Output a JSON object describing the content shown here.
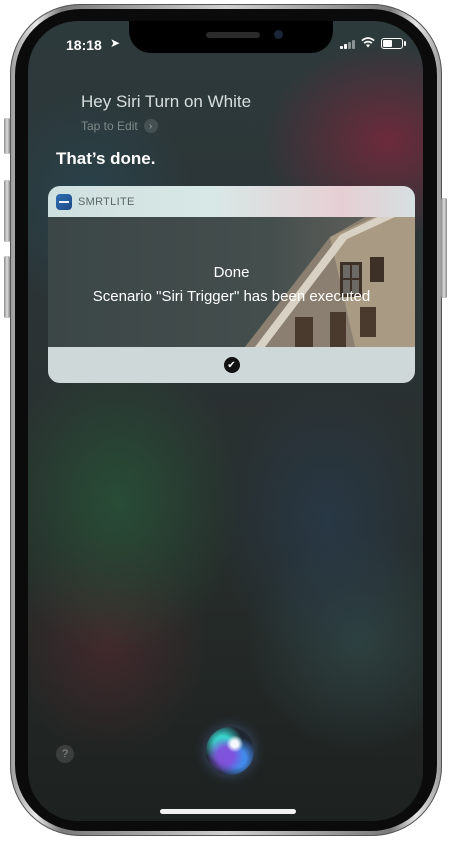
{
  "status_bar": {
    "time": "18:18",
    "location_icon": "location-arrow-icon",
    "signal_icon": "cellular-signal-icon",
    "wifi_icon": "wifi-icon",
    "battery_icon": "battery-icon",
    "battery_level": 0.5
  },
  "siri": {
    "query": "Hey Siri Turn on White",
    "tap_to_edit": "Tap to Edit",
    "response": "That’s done."
  },
  "card": {
    "app_name": "SMRTLITE",
    "title": "Done",
    "message": "Scenario \"Siri Trigger\" has been executed",
    "confirm_icon": "checkmark-icon"
  },
  "bottom": {
    "help_label": "?",
    "siri_icon": "siri-orb-icon"
  },
  "colors": {
    "card_header": "#d8e8e6",
    "card_footer": "#d7e2e1",
    "text_primary": "#ffffff",
    "text_secondary": "#7d8a89"
  }
}
